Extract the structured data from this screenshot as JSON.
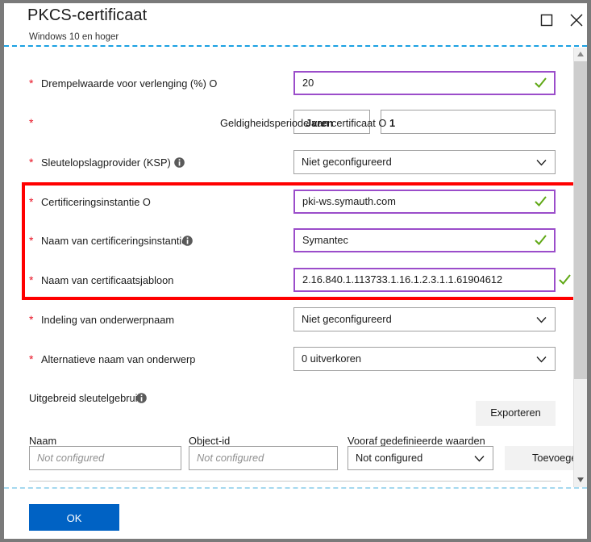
{
  "window": {
    "title": "PKCS-certificaat",
    "subtitle": "Windows 10 en hoger",
    "maximize_label": "Maximize",
    "close_label": "Close"
  },
  "form": {
    "rows": [
      {
        "required": "*",
        "label": "Drempelwaarde voor verlenging (%) O",
        "value": "20",
        "kind": "text-valid"
      },
      {
        "required": "*",
        "label": "Geldigheidsperiode van certificaat O",
        "value_unit": "Jaren",
        "value_number": "1",
        "kind": "validity"
      },
      {
        "required": "*",
        "label": "Sleutelopslagprovider (KSP)",
        "value": "Niet geconfigureerd",
        "kind": "dropdown",
        "info": true
      },
      {
        "required": "*",
        "label": "Certificeringsinstantie O",
        "value": "pki-ws.symauth.com",
        "kind": "text-valid"
      },
      {
        "required": "*",
        "label": "Naam van certificeringsinstantie",
        "value": "Symantec",
        "kind": "text-valid",
        "info": true
      },
      {
        "required": "*",
        "label": "Naam van certificaatsjabloon",
        "value": "2.16.840.1.113733.1.16.1.2.3.1.1.61904612",
        "kind": "text-valid"
      },
      {
        "required": "*",
        "label": "Indeling van onderwerpnaam",
        "value": "Niet geconfigureerd",
        "kind": "dropdown"
      },
      {
        "required": "*",
        "label": "Alternatieve naam van onderwerp",
        "value": "0 uitverkoren",
        "kind": "dropdown"
      }
    ],
    "eku_section_label": "Uitgebreid sleutelgebruik",
    "export_button": "Exporteren",
    "table": {
      "columns": [
        "Naam",
        "Object-id",
        "Vooraf gedefinieerde waarden"
      ],
      "name_placeholder": "Not configured",
      "objectid_placeholder": "Not configured",
      "predefined_value": "Not configured"
    },
    "add_button": "Toevoegen"
  },
  "footer": {
    "ok_label": "OK"
  },
  "colors": {
    "accent_blue": "#0062c4",
    "valid_border": "#9b4dca",
    "valid_check": "#5fa815",
    "required_red": "#e81123",
    "highlight_red": "#ff0000",
    "dashed_separator": "#1ba1e2"
  }
}
